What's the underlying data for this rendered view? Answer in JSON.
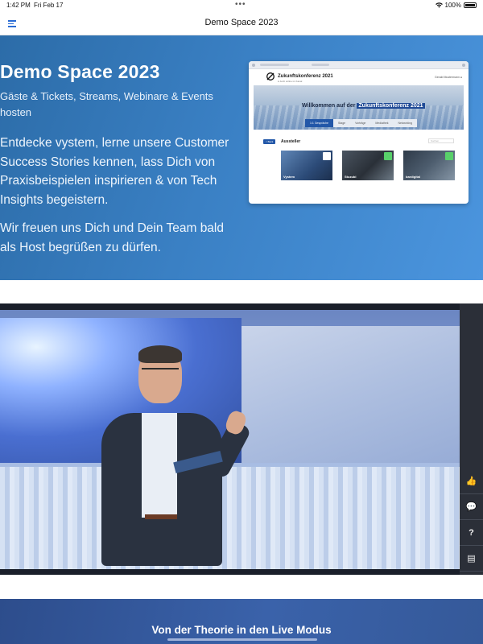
{
  "status_bar": {
    "time": "1:42 PM",
    "date": "Fri Feb 17",
    "battery": "100%"
  },
  "nav": {
    "title": "Demo Space 2023",
    "menu_icon": "hamburger-menu-icon"
  },
  "hero": {
    "title": "Demo Space 2023",
    "subtitle": "Gäste & Tickets, Streams, Webinare & Events hosten",
    "body1": "Entdecke vystem, lerne unsere Customer Success Stories kennen, lass Dich von Praxisbeispielen inspirieren & von Tech Insights begeistern.",
    "body2": "Wir freuen uns Dich und Dein Team bald als Host begrüßen zu dürfen.",
    "background_colors": [
      "#2c6ca8",
      "#4b95de"
    ]
  },
  "mockup": {
    "conference_title": "Zukunftskonferenz 2021",
    "conference_sub": "● Jetzt online im Kanal",
    "user_label": "Gerald Mustermann ●",
    "welcome_prefix": "Willkommen auf der",
    "welcome_highlight": "Zukunftskonferenz 2021",
    "tabs": [
      "1:1 Gespräche",
      "Stage",
      "Vorträge",
      "Mediathek",
      "Networking"
    ],
    "back_label": "< Back",
    "section_title": "Aussteller",
    "search_placeholder": "Suchen",
    "cards": [
      "Vystem",
      "Stuzubi",
      "bardigital"
    ]
  },
  "video": {
    "sidebar_buttons": [
      {
        "icon": "thumbs-up-icon",
        "glyph": "👍"
      },
      {
        "icon": "chat-icon",
        "glyph": "💬"
      },
      {
        "icon": "question-icon",
        "glyph": "?"
      },
      {
        "icon": "notes-icon",
        "glyph": "▤"
      }
    ]
  },
  "bottom": {
    "title": "Von der Theorie in den Live Modus"
  }
}
